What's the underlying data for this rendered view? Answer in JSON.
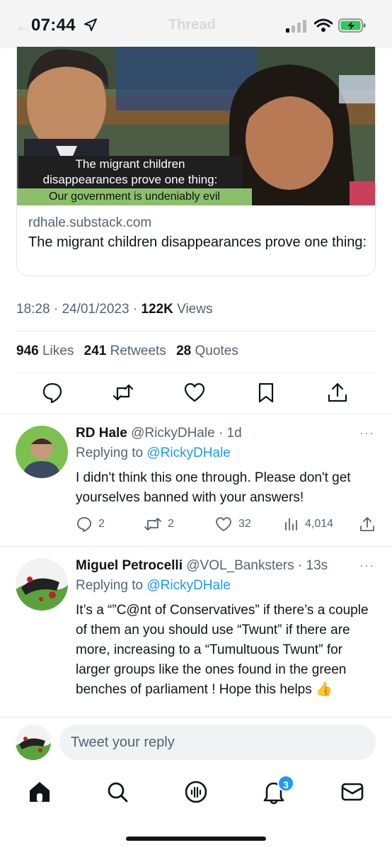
{
  "status_bar": {
    "time": "07:44",
    "ghost_title": "Thread",
    "ghost_back": "←"
  },
  "link_card": {
    "caption_line1": "The migrant children",
    "caption_line2": "disappearances prove one thing:",
    "caption_line3": "Our government is undeniably evil",
    "domain": "rdhale.substack.com",
    "title": "The migrant children disappearances prove one thing:"
  },
  "tweet_meta": {
    "time": "18:28",
    "dot1": " · ",
    "date": "24/01/2023",
    "dot2": " · ",
    "views_count": "122K",
    "views_label": " Views"
  },
  "stats": {
    "likes_count": "946",
    "likes_label": " Likes",
    "retweets_count": "241",
    "retweets_label": " Retweets",
    "quotes_count": "28",
    "quotes_label": " Quotes"
  },
  "replies": [
    {
      "name": "RD Hale",
      "handle": " @RickyDHale · 1d",
      "more": "···",
      "replying_prefix": "Replying to ",
      "replying_to": "@RickyDHale",
      "body": "I didn't think this one through. Please don't get yourselves banned with your answers!",
      "reply_count": "2",
      "retweet_count": "2",
      "like_count": "32",
      "view_count": "4,014"
    },
    {
      "name": "Miguel Petrocelli",
      "handle": " @VOL_Banksters · 13s",
      "more": "···",
      "replying_prefix": "Replying to ",
      "replying_to": "@RickyDHale",
      "body": "It’s a “”C@nt of Conservatives” if there’s a couple of them an you should use “Twunt” if there are more, increasing to a “Tumultuous Twunt” for larger groups like the ones found in the green benches of parliament ! Hope this helps 👍"
    }
  ],
  "compose": {
    "placeholder": "Tweet your reply"
  },
  "tab_bar": {
    "notifications_badge": "3"
  },
  "colors": {
    "accent": "#1d9bf0",
    "secondary_text": "#536471",
    "caption_green": "#8bbf6b"
  },
  "icons": {
    "status": [
      "location-arrow-icon",
      "signal-icon",
      "wifi-icon",
      "battery-charging-icon"
    ],
    "actions": [
      "reply-icon",
      "retweet-icon",
      "like-icon",
      "bookmark-icon",
      "share-icon"
    ],
    "tabs": [
      "home-icon",
      "search-icon",
      "spaces-icon",
      "notifications-icon",
      "messages-icon"
    ]
  }
}
